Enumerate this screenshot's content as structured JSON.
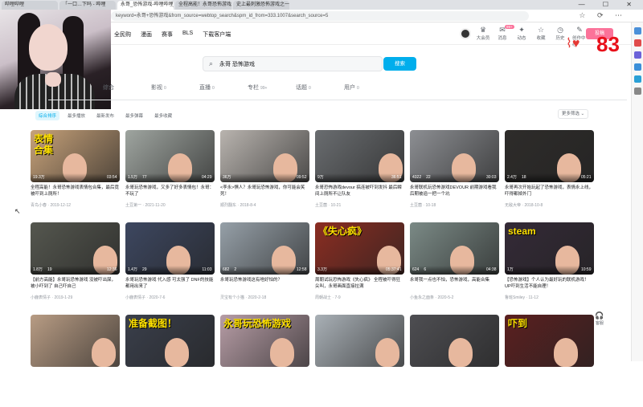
{
  "browser": {
    "tabs": [
      "哔哩哔哩",
      "「一口…下吗 - 哔哩",
      "永哥_恐怖游戏-哔哩哔哩_Bilibili",
      "全程高能！永哥恐怖游戏表情包合集",
      "史上最刺激恐怖游戏之一 (恐怖)"
    ],
    "url": "keyword=永哥+恐怖游戏&from_source=webtop_search&spm_id_from=333.1007&search_source=5"
  },
  "header": {
    "nav": [
      "全民购",
      "漫画",
      "赛事",
      "BLS",
      "下载客户端"
    ],
    "icons": [
      {
        "label": "大会员",
        "icon": "vip-icon"
      },
      {
        "label": "消息",
        "icon": "message-icon"
      },
      {
        "label": "动态",
        "icon": "dynamic-icon"
      },
      {
        "label": "收藏",
        "icon": "favorite-icon"
      },
      {
        "label": "历史",
        "icon": "history-icon"
      },
      {
        "label": "创作中心",
        "icon": "creator-icon"
      }
    ],
    "message_badge": "99+",
    "upload_label": "投稿"
  },
  "overlay": {
    "heart_rate": "83",
    "heart_color": "#e53935"
  },
  "search": {
    "query": "永哥 恐怖游戏",
    "button_label": "搜索"
  },
  "categories": [
    {
      "label": "综合",
      "count": ""
    },
    {
      "label": "影视",
      "count": "0"
    },
    {
      "label": "直播",
      "count": "0"
    },
    {
      "label": "专栏",
      "count": "99+"
    },
    {
      "label": "话题",
      "count": "0"
    },
    {
      "label": "用户",
      "count": "0"
    }
  ],
  "filters": [
    "综合排序",
    "最多播放",
    "最新发布",
    "最多弹幕",
    "最多收藏"
  ],
  "more_filters": "更多筛选",
  "videos": [
    {
      "thumb_text": "表情\n合集",
      "views": "19.3万",
      "danmaku": "",
      "duration": "03:54",
      "title_hl": "",
      "title": "全程高能！永哥恐怖游戏表情包合集，最后竟被吓到上厕所！",
      "up": "青鸟小春 · 2019-12-12",
      "bg": "#c7a27a"
    },
    {
      "thumb_text": "",
      "views": "1.5万",
      "danmaku": "77",
      "duration": "04:29",
      "title_hl": "",
      "title": "永哥玩恐怖游戏，又多了好多表情包！永哥：不玩了",
      "up": "土豆第一 · 2021-11-20",
      "bg": "#9fa5a0"
    },
    {
      "thumb_text": "",
      "views": "36万",
      "danmaku": "",
      "duration": "09:52",
      "title_hl": "",
      "title": "<李永>惧人？永哥玩恐怖游戏，你可能会笑死！",
      "up": "顺烈翻东 · 2018-8-4",
      "bg": "#b9b4af"
    },
    {
      "thumb_text": "",
      "views": "9万",
      "danmaku": "",
      "duration": "36:51",
      "title_hl": "",
      "title": "永哥恐怖游戏devour 搞连被吓到发抖 最后瞬间上厕所不让队友",
      "up": "土豆菌 · 10-21",
      "bg": "#6a6d70"
    },
    {
      "thumb_text": "",
      "views": "4322",
      "danmaku": "22",
      "duration": "30:03",
      "title_hl": "",
      "title": "永哥联机玩恐怖游戏DEVOUR 前期游戏看我 后期被追一把一个坑",
      "up": "土豆菌 · 10-18",
      "bg": "#8d8f93"
    },
    {
      "thumb_text": "",
      "views": "2.4万",
      "danmaku": "18",
      "duration": "05:21",
      "title_hl": "",
      "title": "永哥再次开始玩起了恐怖游戏，表情永上线，吓得都掉外门",
      "up": "无敌大帝 · 2018-10-8",
      "bg": "#2e2c2a"
    },
    {
      "thumb_text": "",
      "views": "1.8万",
      "danmaku": "19",
      "duration": "12:36",
      "title_hl": "",
      "title": "【前方高能】永哥玩恐怖游戏 没被吓出屎，被小吓到了 自己吓自己",
      "up": "小鹿表情子 · 2019-1-29",
      "bg": "#55574f"
    },
    {
      "thumb_text": "",
      "views": "1.4万",
      "danmaku": "29",
      "duration": "11:03",
      "title_hl": "",
      "title": "永哥玩恐怖游戏 代入感 可太强了 DNF的技能 都用出来了",
      "up": "小鹿表情子 · 2020-7-6",
      "bg": "#3d4760"
    },
    {
      "thumb_text": "",
      "views": "682",
      "danmaku": "2",
      "duration": "12:58",
      "title_hl": "",
      "title": "永哥玩恐怖游戏这有啥好怕的？",
      "up": "灵宝有个小猫 · 2020-2-18",
      "bg": "#96a0a8"
    },
    {
      "thumb_text": "《失心疯》",
      "views": "3.3万",
      "danmaku": "",
      "duration": "05:37:41",
      "title_hl": "",
      "title": "周朝试玩恐怖游戏《失心疯》 全程被吓得狂尖叫，永哥画面直接拉满",
      "up": "周朝战士 · 7-9",
      "bg": "#8b2d22"
    },
    {
      "thumb_text": "",
      "views": "624",
      "danmaku": "6",
      "duration": "04:38",
      "title_hl": "",
      "title": "永哥我一点也不怕，恐怖游戏，高能合集",
      "up": "小鱼永之面条 · 2020-5-2",
      "bg": "#7b8a86"
    },
    {
      "thumb_text": "steam",
      "views": "1万",
      "danmaku": "",
      "duration": "10:59",
      "title_hl": "",
      "title": "【恐怖游戏】个人认为最好玩的联机游戏！ UP吓到生活不能自理！",
      "up": "鲁班Smiley · 11-12",
      "bg": "#342a37"
    },
    {
      "thumb_text": "",
      "views": "",
      "danmaku": "",
      "duration": "",
      "title_hl": "",
      "title": "",
      "up": "",
      "bg": "#b89c84"
    },
    {
      "thumb_text": "准备截图！",
      "views": "",
      "danmaku": "",
      "duration": "",
      "title_hl": "",
      "title": "",
      "up": "",
      "bg": "#3a3f4b"
    },
    {
      "thumb_text": "永哥玩恐怖游戏",
      "views": "",
      "danmaku": "",
      "duration": "",
      "title_hl": "",
      "title": "",
      "up": "",
      "bg": "#b79da6"
    },
    {
      "thumb_text": "",
      "views": "",
      "danmaku": "",
      "duration": "",
      "title_hl": "",
      "title": "",
      "up": "",
      "bg": "#a9b0b6"
    },
    {
      "thumb_text": "",
      "views": "",
      "danmaku": "",
      "duration": "",
      "title_hl": "",
      "title": "",
      "up": "",
      "bg": "#4e4e52"
    },
    {
      "thumb_text": "吓到",
      "views": "",
      "danmaku": "",
      "duration": "",
      "title_hl": "",
      "title": "",
      "up": "",
      "bg": "#5b2020"
    }
  ],
  "fixbtn_label": "客服"
}
